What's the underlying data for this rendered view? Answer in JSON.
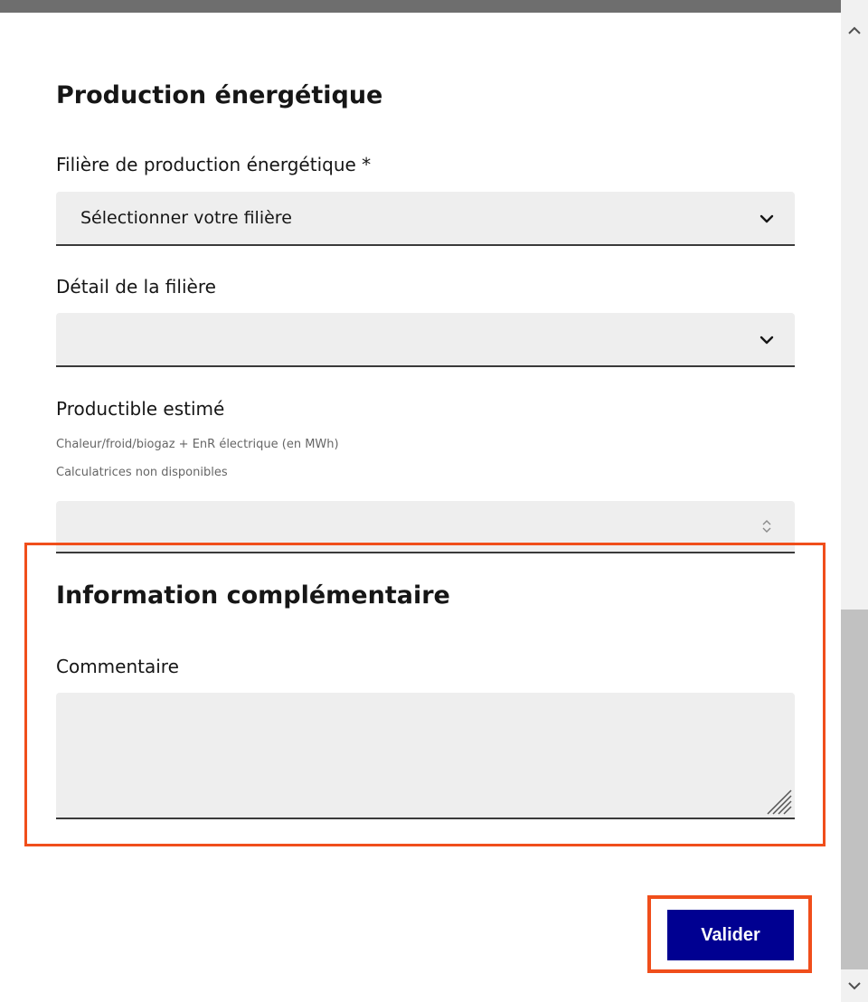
{
  "production": {
    "title": "Production énergétique",
    "filiere_label": "Filière de production énergétique *",
    "filiere_selected": "Sélectionner votre filière",
    "detail_label": "Détail de la filière",
    "detail_selected": "",
    "productible_label": "Productible estimé",
    "productible_hint1": "Chaleur/froid/biogaz + EnR électrique (en MWh)",
    "productible_hint2": "Calculatrices non disponibles",
    "productible_value": ""
  },
  "info": {
    "title": "Information complémentaire",
    "commentaire_label": "Commentaire",
    "commentaire_value": ""
  },
  "actions": {
    "submit_label": "Valider"
  },
  "colors": {
    "primary_button": "#000091",
    "highlight": "#f04e1b",
    "field_bg": "#eeeeee"
  },
  "icons": [
    "chevron-down-icon",
    "number-spin-icon",
    "resize-handle-icon",
    "scroll-up-arrow-icon",
    "scroll-down-arrow-icon"
  ]
}
